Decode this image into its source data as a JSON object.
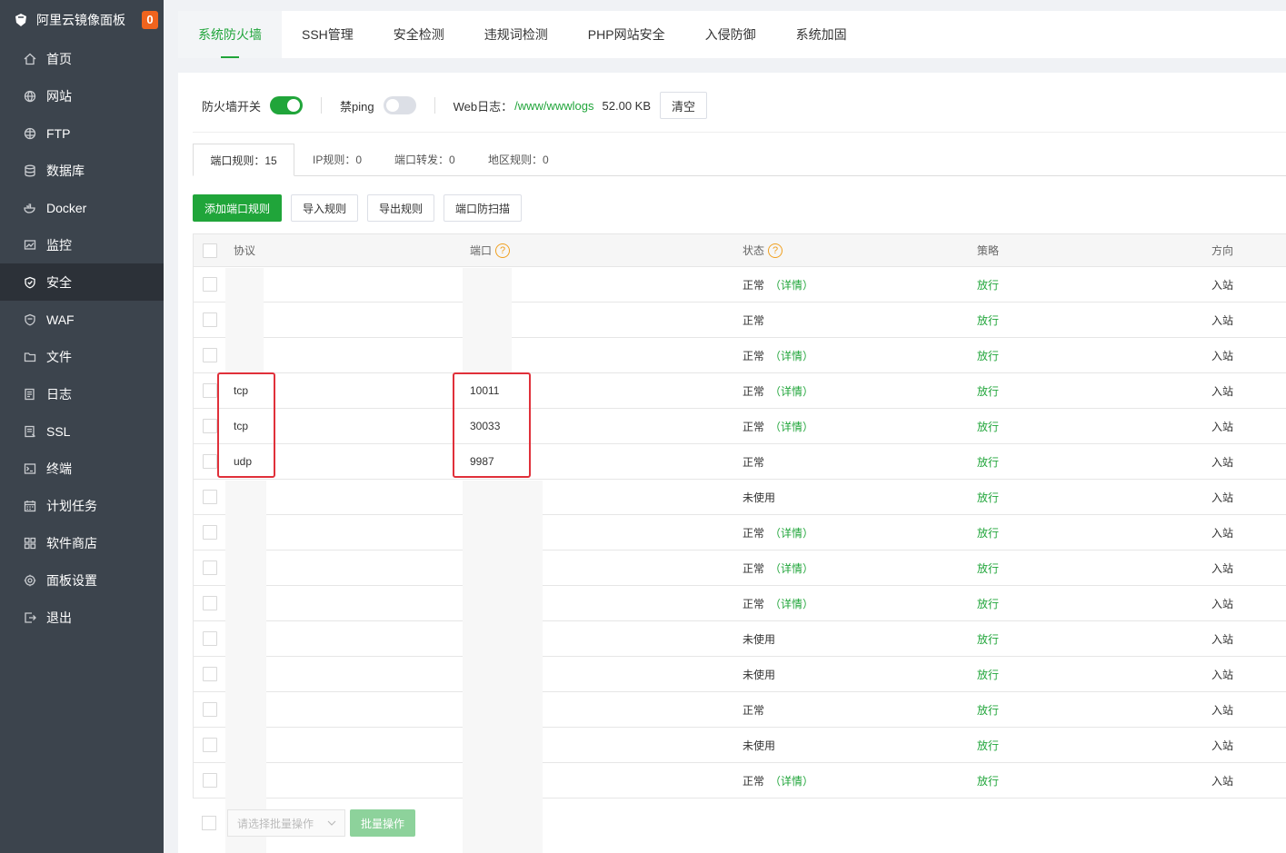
{
  "brand": {
    "title": "阿里云镜像面板",
    "badge": "0"
  },
  "sidebar": {
    "items": [
      {
        "label": "首页",
        "icon": "home-icon"
      },
      {
        "label": "网站",
        "icon": "globe-icon"
      },
      {
        "label": "FTP",
        "icon": "ftp-icon"
      },
      {
        "label": "数据库",
        "icon": "database-icon"
      },
      {
        "label": "Docker",
        "icon": "docker-icon"
      },
      {
        "label": "监控",
        "icon": "monitor-icon"
      },
      {
        "label": "安全",
        "icon": "shield-icon",
        "active": true
      },
      {
        "label": "WAF",
        "icon": "waf-icon"
      },
      {
        "label": "文件",
        "icon": "folder-icon"
      },
      {
        "label": "日志",
        "icon": "log-icon"
      },
      {
        "label": "SSL",
        "icon": "ssl-icon"
      },
      {
        "label": "终端",
        "icon": "terminal-icon"
      },
      {
        "label": "计划任务",
        "icon": "calendar-icon"
      },
      {
        "label": "软件商店",
        "icon": "apps-icon"
      },
      {
        "label": "面板设置",
        "icon": "gear-icon"
      },
      {
        "label": "退出",
        "icon": "logout-icon"
      }
    ]
  },
  "tabs": [
    "系统防火墙",
    "SSH管理",
    "安全检测",
    "违规词检测",
    "PHP网站安全",
    "入侵防御",
    "系统加固"
  ],
  "toolbar": {
    "firewall_label": "防火墙开关",
    "ping_label": "禁ping",
    "weblog_label": "Web日志：",
    "weblog_path": "/www/wwwlogs",
    "weblog_size": "52.00 KB",
    "clear_label": "清空"
  },
  "subtabs": [
    "端口规则：15",
    "IP规则：0",
    "端口转发：0",
    "地区规则：0"
  ],
  "buttons": {
    "add": "添加端口规则",
    "import": "导入规则",
    "export": "导出规则",
    "scan": "端口防扫描"
  },
  "table": {
    "headers": {
      "protocol": "协议",
      "port": "端口",
      "status": "状态",
      "policy": "策略",
      "direction": "方向"
    },
    "detail_label": "（详情）",
    "rows": [
      {
        "protocol": "",
        "port": "",
        "status": "正常",
        "detail": true,
        "policy": "放行",
        "direction": "入站"
      },
      {
        "protocol": "",
        "port": "",
        "status": "正常",
        "detail": false,
        "policy": "放行",
        "direction": "入站"
      },
      {
        "protocol": "",
        "port": "",
        "status": "正常",
        "detail": true,
        "policy": "放行",
        "direction": "入站"
      },
      {
        "protocol": "tcp",
        "port": "10011",
        "status": "正常",
        "detail": true,
        "policy": "放行",
        "direction": "入站"
      },
      {
        "protocol": "tcp",
        "port": "30033",
        "status": "正常",
        "detail": true,
        "policy": "放行",
        "direction": "入站"
      },
      {
        "protocol": "udp",
        "port": "9987",
        "status": "正常",
        "detail": false,
        "policy": "放行",
        "direction": "入站"
      },
      {
        "protocol": "",
        "port": "",
        "status": "未使用",
        "detail": false,
        "policy": "放行",
        "direction": "入站"
      },
      {
        "protocol": "",
        "port": "",
        "status": "正常",
        "detail": true,
        "policy": "放行",
        "direction": "入站"
      },
      {
        "protocol": "",
        "port": "",
        "status": "正常",
        "detail": true,
        "policy": "放行",
        "direction": "入站"
      },
      {
        "protocol": "",
        "port": "",
        "status": "正常",
        "detail": true,
        "policy": "放行",
        "direction": "入站"
      },
      {
        "protocol": "",
        "port": "",
        "status": "未使用",
        "detail": false,
        "policy": "放行",
        "direction": "入站"
      },
      {
        "protocol": "",
        "port": "",
        "status": "未使用",
        "detail": false,
        "policy": "放行",
        "direction": "入站"
      },
      {
        "protocol": "",
        "port": "",
        "status": "正常",
        "detail": false,
        "policy": "放行",
        "direction": "入站"
      },
      {
        "protocol": "",
        "port": "",
        "status": "未使用",
        "detail": false,
        "policy": "放行",
        "direction": "入站"
      },
      {
        "protocol": "",
        "port": "",
        "status": "正常",
        "detail": true,
        "policy": "放行",
        "direction": "入站"
      }
    ]
  },
  "footer": {
    "select_placeholder": "请选择批量操作",
    "batch_label": "批量操作"
  },
  "colors": {
    "accent": "#20a53a",
    "sidebar": "#3c444d",
    "highlight": "#e0303a",
    "badge": "#f0641e"
  }
}
